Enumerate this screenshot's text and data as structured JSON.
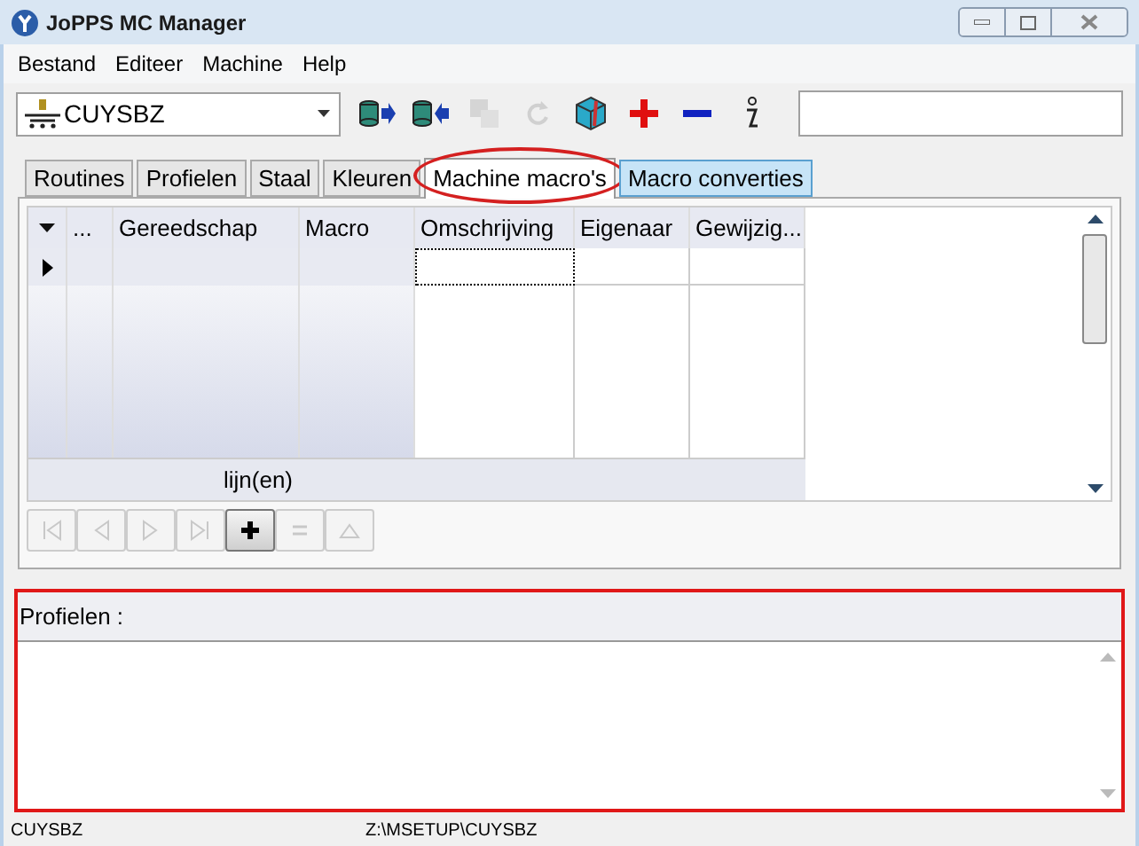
{
  "window": {
    "title": "JoPPS MC Manager"
  },
  "menu": [
    "Bestand",
    "Editeer",
    "Machine",
    "Help"
  ],
  "machine_select": {
    "value": "CUYSBZ"
  },
  "toolbar": [
    {
      "kind": "export",
      "disabled": false
    },
    {
      "kind": "import",
      "disabled": false
    },
    {
      "kind": "copy",
      "disabled": true
    },
    {
      "kind": "refresh",
      "disabled": true
    },
    {
      "kind": "cube",
      "disabled": false
    },
    {
      "kind": "add",
      "disabled": false
    },
    {
      "kind": "remove",
      "disabled": false
    },
    {
      "kind": "info",
      "disabled": false
    }
  ],
  "tabs": [
    {
      "label": "Routines",
      "selected": false,
      "hover": false,
      "highlighted": false
    },
    {
      "label": "Profielen",
      "selected": false,
      "hover": false,
      "highlighted": false
    },
    {
      "label": "Staal",
      "selected": false,
      "hover": false,
      "highlighted": false
    },
    {
      "label": "Kleuren",
      "selected": false,
      "hover": false,
      "highlighted": false
    },
    {
      "label": "Machine macro's",
      "selected": true,
      "hover": false,
      "highlighted": true
    },
    {
      "label": "Macro converties",
      "selected": false,
      "hover": true,
      "highlighted": false
    }
  ],
  "table": {
    "columns": [
      "...",
      "Gereedschap",
      "Macro",
      "Omschrijving",
      "Eigenaar",
      "Gewijzig..."
    ],
    "footer": "lijn(en)"
  },
  "navigator": [
    {
      "kind": "first",
      "disabled": true
    },
    {
      "kind": "prior",
      "disabled": true
    },
    {
      "kind": "next",
      "disabled": true
    },
    {
      "kind": "last",
      "disabled": true
    },
    {
      "kind": "insert",
      "disabled": false
    },
    {
      "kind": "post",
      "disabled": true
    },
    {
      "kind": "up",
      "disabled": true
    }
  ],
  "profielen_panel": {
    "label": "Profielen :",
    "highlighted": true
  },
  "status_bar": [
    "CUYSBZ",
    "Z:\\MSETUP\\CUYSBZ"
  ]
}
